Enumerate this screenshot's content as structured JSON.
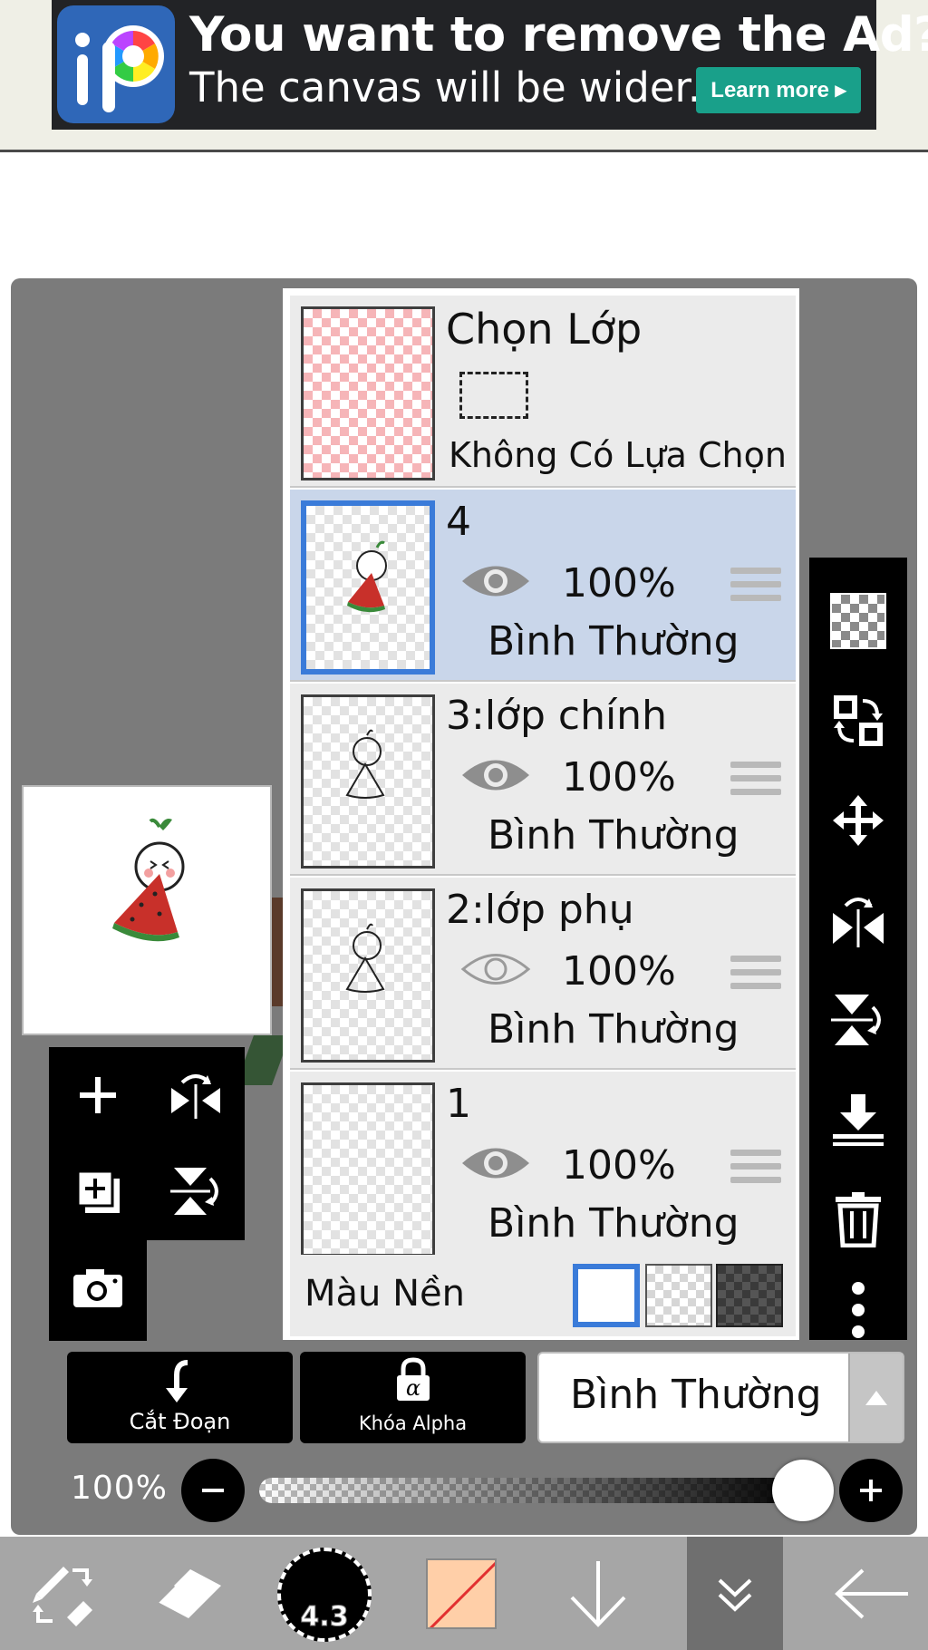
{
  "ad": {
    "title": "You want to remove the Ad?",
    "subtitle": "The canvas will be wider.",
    "learn_more": "Learn more ▸",
    "logo_letters": "iP"
  },
  "selection_layer": {
    "title": "Chọn Lớp",
    "status": "Không Có Lựa Chọn"
  },
  "layers": [
    {
      "name": "4",
      "opacity": "100%",
      "blend": "Bình Thường",
      "visible": true,
      "selected": true
    },
    {
      "name": "3:lớp chính",
      "opacity": "100%",
      "blend": "Bình Thường",
      "visible": true,
      "selected": false
    },
    {
      "name": "2:lớp phụ",
      "opacity": "100%",
      "blend": "Bình Thường",
      "visible": false,
      "selected": false
    },
    {
      "name": "1",
      "opacity": "100%",
      "blend": "Bình Thường",
      "visible": true,
      "selected": false
    }
  ],
  "background": {
    "label": "Màu Nền",
    "options": [
      "white",
      "checker",
      "dark-checker"
    ],
    "selected": "white"
  },
  "controls": {
    "clipping_label": "Cắt Đoạn",
    "alpha_lock_label": "Khóa Alpha",
    "blend_mode": "Bình Thường",
    "opacity_label": "100%",
    "opacity_value": 1.0
  },
  "toolbar": {
    "brush_size": "4.3",
    "active_tool": "layers"
  },
  "colors": {
    "accent_blue": "#3a7bd9",
    "selected_row": "#c9d6ea",
    "ad_button": "#19a08a",
    "current_color": "#ffcfa8"
  }
}
